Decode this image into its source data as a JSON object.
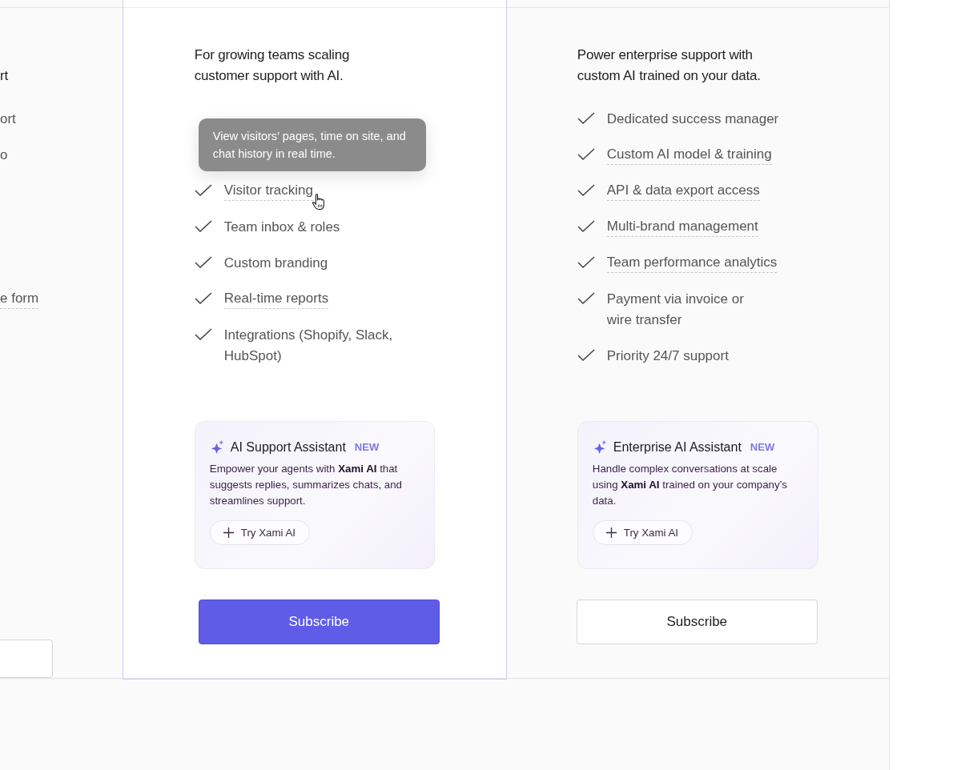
{
  "columns": [
    {
      "kind": "partial",
      "heading": "rt",
      "features": [
        {
          "label": "ort",
          "has_tooltip": false
        },
        {
          "label": "o",
          "has_tooltip": false
        },
        {
          "label": "e form",
          "has_tooltip": true
        }
      ],
      "button": {
        "kind": "outline"
      }
    },
    {
      "kind": "featured",
      "heading": "For growing teams scaling customer support with AI.",
      "features": [
        {
          "label": "Visitor tracking",
          "has_tooltip": true
        },
        {
          "label": "Team inbox & roles",
          "has_tooltip": false
        },
        {
          "label": "Custom branding",
          "has_tooltip": false
        },
        {
          "label": "Real-time reports",
          "has_tooltip": true
        },
        {
          "label": "Integrations (Shopify, Slack,\nHubSpot)",
          "has_tooltip": false
        }
      ],
      "tooltip": {
        "text": "View visitors’ pages, time on site, and chat history in real time."
      },
      "ai_card": {
        "title": "AI Support Assistant",
        "badge": "NEW",
        "description": "Empower your agents with **Xami AI** that suggests replies, summarizes chats, and streamlines support.",
        "action": "Try Xami AI"
      },
      "button": {
        "kind": "primary",
        "label": "Subscribe"
      }
    },
    {
      "kind": "full",
      "heading": "Power enterprise support with custom AI trained on your data.",
      "features": [
        {
          "label": "Dedicated success manager",
          "has_tooltip": false
        },
        {
          "label": "Custom AI model & training",
          "has_tooltip": true
        },
        {
          "label": "API & data export access",
          "has_tooltip": true
        },
        {
          "label": "Multi-brand management",
          "has_tooltip": true
        },
        {
          "label": "Team performance analytics",
          "has_tooltip": true
        },
        {
          "label": "Payment via invoice or\nwire transfer",
          "has_tooltip": false
        },
        {
          "label": "Priority 24/7 support",
          "has_tooltip": false
        }
      ],
      "ai_card": {
        "title": "Enterprise AI Assistant",
        "badge": "NEW",
        "description": "Handle complex conversations at scale using **Xami AI** trained on your company’s data.",
        "action": "Try Xami AI"
      },
      "button": {
        "kind": "outline",
        "label": "Subscribe"
      }
    }
  ]
}
